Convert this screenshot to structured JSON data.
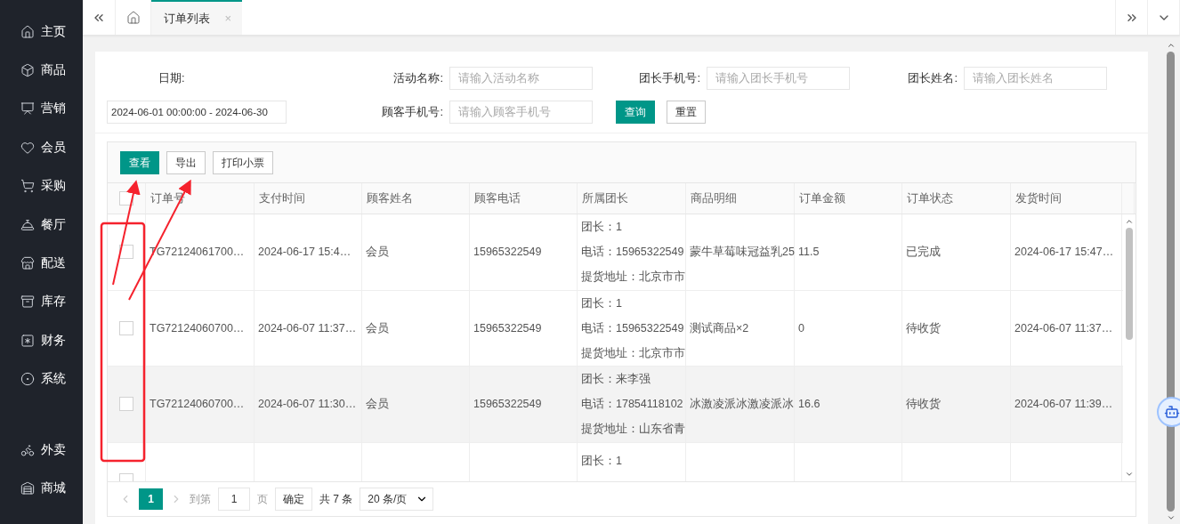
{
  "sidebar": {
    "groups": [
      [
        {
          "label": "主页"
        },
        {
          "label": "商品"
        },
        {
          "label": "营销"
        },
        {
          "label": "会员"
        },
        {
          "label": "采购"
        },
        {
          "label": "餐厅"
        },
        {
          "label": "配送"
        },
        {
          "label": "库存"
        },
        {
          "label": "财务"
        },
        {
          "label": "系统"
        }
      ],
      [
        {
          "label": "外卖"
        },
        {
          "label": "商城"
        }
      ]
    ]
  },
  "tabs": [
    {
      "label": "订单列表",
      "selected": true,
      "close": "×"
    }
  ],
  "filters": {
    "date": {
      "label": "日期:",
      "value": "2024-06-01 00:00:00 - 2024-06-30"
    },
    "fields": [
      {
        "label": "活动名称:",
        "placeholder": "请输入活动名称"
      },
      {
        "label": "团长手机号:",
        "placeholder": "请输入团长手机号"
      },
      {
        "label": "团长姓名:",
        "placeholder": "请输入团长姓名"
      },
      {
        "label": "顾客手机号:",
        "placeholder": "请输入顾客手机号"
      }
    ],
    "buttons": [
      {
        "label": "查询",
        "primary": true
      },
      {
        "label": "重置",
        "primary": false
      }
    ]
  },
  "toolbar": [
    {
      "label": "查看",
      "primary": true
    },
    {
      "label": "导出",
      "primary": false
    },
    {
      "label": "打印小票",
      "primary": false
    }
  ],
  "table": {
    "all_checked": false,
    "columns": [
      "订单号",
      "支付时间",
      "顾客姓名",
      "顾客电话",
      "所属团长",
      "商品明细",
      "订单金额",
      "订单状态",
      "发货时间"
    ],
    "rows": [
      {
        "checked": false,
        "highlighted": false,
        "order_no": "TG72124061700…",
        "paid_at": "2024-06-17 15:4…",
        "customer": "会员",
        "phone": "15965322549",
        "leader": [
          "团长：1",
          "电话：15965322549",
          "提货地址：北京市市"
        ],
        "goods": "蒙牛草莓味冠益乳25",
        "amount": "11.5",
        "status": "已完成",
        "shipped_at": "2024-06-17 15:47…"
      },
      {
        "checked": false,
        "highlighted": false,
        "order_no": "TG72124060700…",
        "paid_at": "2024-06-07 11:37…",
        "customer": "会员",
        "phone": "15965322549",
        "leader": [
          "团长：1",
          "电话：15965322549",
          "提货地址：北京市市"
        ],
        "goods": "测试商品×2",
        "amount": "0",
        "status": "待收货",
        "shipped_at": "2024-06-07 11:37…"
      },
      {
        "checked": false,
        "highlighted": true,
        "order_no": "TG72124060700…",
        "paid_at": "2024-06-07 11:30…",
        "customer": "会员",
        "phone": "15965322549",
        "leader": [
          "团长：来李强",
          "电话：17854118102",
          "提货地址：山东省青"
        ],
        "goods": "冰激凌派冰激凌派冰",
        "amount": "16.6",
        "status": "待收货",
        "shipped_at": "2024-06-07 11:39…"
      },
      {
        "checked": false,
        "highlighted": false,
        "leader": [
          "团长：1"
        ]
      }
    ]
  },
  "pagination": {
    "pages": [
      {
        "label": "1",
        "selected": true
      }
    ],
    "goto_label": "到第",
    "goto_value": "1",
    "page_unit": "页",
    "confirm": "确定",
    "total": "共 7 条",
    "page_size": "20 条/页"
  }
}
